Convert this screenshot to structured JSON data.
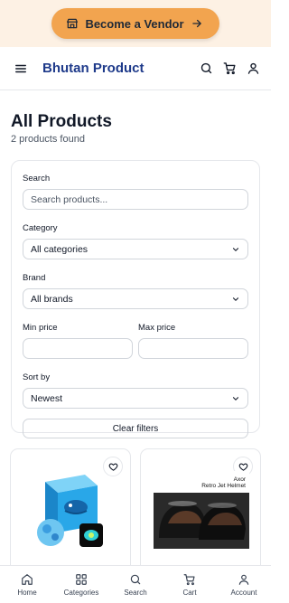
{
  "promo": {
    "vendor_label": "Become a Vendor"
  },
  "header": {
    "brand": "Bhutan Product"
  },
  "main": {
    "title": "All Products",
    "count_text": "2 products found"
  },
  "filters": {
    "search_label": "Search",
    "search_placeholder": "Search products...",
    "category_label": "Category",
    "category_value": "All categories",
    "brand_label": "Brand",
    "brand_value": "All brands",
    "min_price_label": "Min price",
    "max_price_label": "Max price",
    "sort_label": "Sort by",
    "sort_value": "Newest",
    "clear_label": "Clear filters"
  },
  "products": [
    {
      "image_icon": "blue-cube-toy-image"
    },
    {
      "image_icon": "helmet-image",
      "image_caption": "Axor",
      "image_subcaption": "Retro Jet Helmet"
    }
  ],
  "tabbar": {
    "items": [
      {
        "label": "Home",
        "icon": "home-icon"
      },
      {
        "label": "Categories",
        "icon": "grid-icon"
      },
      {
        "label": "Search",
        "icon": "search-icon"
      },
      {
        "label": "Cart",
        "icon": "cart-icon"
      },
      {
        "label": "Account",
        "icon": "user-icon"
      }
    ]
  },
  "colors": {
    "promo_bg": "#fdf1e4",
    "vendor_button": "#f2a44f",
    "brand": "#1e3a8a"
  }
}
